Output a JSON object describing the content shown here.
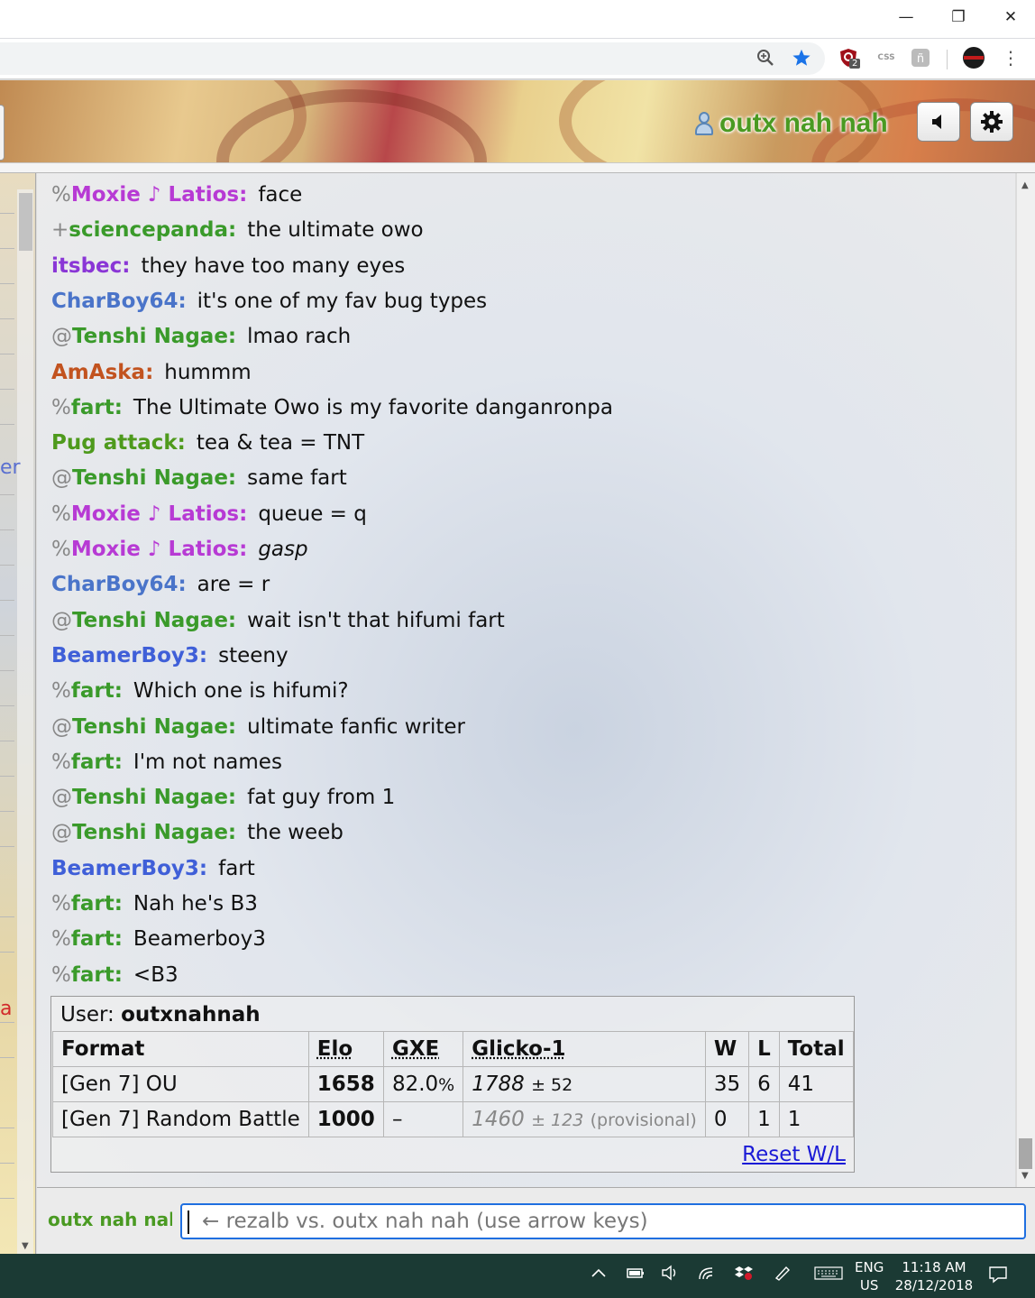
{
  "window": {
    "minimize": "—",
    "restore": "❐",
    "close": "✕"
  },
  "toolbar": {
    "zoom_icon": "zoom-icon",
    "star_icon": "bookmark-star-icon",
    "ext_badge": "2",
    "ext_css_label": "CSS",
    "menu_icon": "more-vert-icon"
  },
  "header": {
    "username": "outx nah nah",
    "sound_icon": "volume-icon",
    "settings_icon": "gear-icon"
  },
  "sidebar": {
    "fragments": [
      {
        "text": "er",
        "color": "#5a6fd0"
      },
      {
        "text": "a",
        "color": "#d22a2a"
      }
    ]
  },
  "chat": {
    "messages": [
      {
        "rank": "%",
        "user": "Moxie ♪ Latios:",
        "color": "purple",
        "text": "face"
      },
      {
        "rank": "+",
        "user": "sciencepanda:",
        "color": "green",
        "text": "the ultimate owo"
      },
      {
        "rank": "",
        "user": "itsbec:",
        "color": "violet",
        "text": "they have too many eyes"
      },
      {
        "rank": "",
        "user": "CharBoy64:",
        "color": "blue",
        "text": "it's one of my fav bug types"
      },
      {
        "rank": "@",
        "user": "Tenshi Nagae:",
        "color": "green",
        "text": "lmao rach"
      },
      {
        "rank": "",
        "user": "AmAska:",
        "color": "rust",
        "text": "hummm"
      },
      {
        "rank": "%",
        "user": "fart:",
        "color": "green",
        "text": "The Ultimate Owo is my favorite danganronpa"
      },
      {
        "rank": "",
        "user": "Pug attack:",
        "color": "olive",
        "text": "tea & tea = TNT"
      },
      {
        "rank": "@",
        "user": "Tenshi Nagae:",
        "color": "green",
        "text": "same fart"
      },
      {
        "rank": "%",
        "user": "Moxie ♪ Latios:",
        "color": "purple",
        "text": "queue = q"
      },
      {
        "rank": "%",
        "user": "Moxie ♪ Latios:",
        "color": "purple",
        "text": "gasp",
        "italic": true
      },
      {
        "rank": "",
        "user": "CharBoy64:",
        "color": "blue",
        "text": "are = r"
      },
      {
        "rank": "@",
        "user": "Tenshi Nagae:",
        "color": "green",
        "text": "wait isn't that hifumi fart"
      },
      {
        "rank": "",
        "user": "BeamerBoy3:",
        "color": "royal",
        "text": "steeny"
      },
      {
        "rank": "%",
        "user": "fart:",
        "color": "green",
        "text": "Which one is hifumi?"
      },
      {
        "rank": "@",
        "user": "Tenshi Nagae:",
        "color": "green",
        "text": "ultimate fanfic writer"
      },
      {
        "rank": "%",
        "user": "fart:",
        "color": "green",
        "text": "I'm not names"
      },
      {
        "rank": "@",
        "user": "Tenshi Nagae:",
        "color": "green",
        "text": "fat guy from 1"
      },
      {
        "rank": "@",
        "user": "Tenshi Nagae:",
        "color": "green",
        "text": "the weeb"
      },
      {
        "rank": "",
        "user": "BeamerBoy3:",
        "color": "royal",
        "text": "fart"
      },
      {
        "rank": "%",
        "user": "fart:",
        "color": "green",
        "text": "Nah he's B3"
      },
      {
        "rank": "%",
        "user": "fart:",
        "color": "green",
        "text": "Beamerboy3"
      },
      {
        "rank": "%",
        "user": "fart:",
        "color": "green",
        "text": "<B3"
      }
    ]
  },
  "ranking": {
    "user_label": "User:",
    "username": "outxnahnah",
    "headers": [
      "Format",
      "Elo",
      "GXE",
      "Glicko-1",
      "W",
      "L",
      "Total"
    ],
    "rows": [
      {
        "format": "[Gen 7] OU",
        "elo": "1658",
        "gxe": "82.0",
        "gxe_unit": "%",
        "glicko": "1788",
        "glicko_dev": "± 52",
        "provisional": "",
        "w": "35",
        "l": "6",
        "total": "41"
      },
      {
        "format": "[Gen 7] Random Battle",
        "elo": "1000",
        "gxe": "–",
        "gxe_unit": "",
        "glicko": "1460",
        "glicko_dev": "± 123",
        "provisional": "(provisional)",
        "w": "0",
        "l": "1",
        "total": "1"
      }
    ],
    "reset_link": "Reset W/L"
  },
  "input": {
    "self_name": "outx nah nah",
    "placeholder": "← rezalb vs. outx nah nah (use arrow keys)"
  },
  "taskbar": {
    "lang_top": "ENG",
    "lang_bottom": "US",
    "time": "11:18 AM",
    "date": "28/12/2018"
  }
}
